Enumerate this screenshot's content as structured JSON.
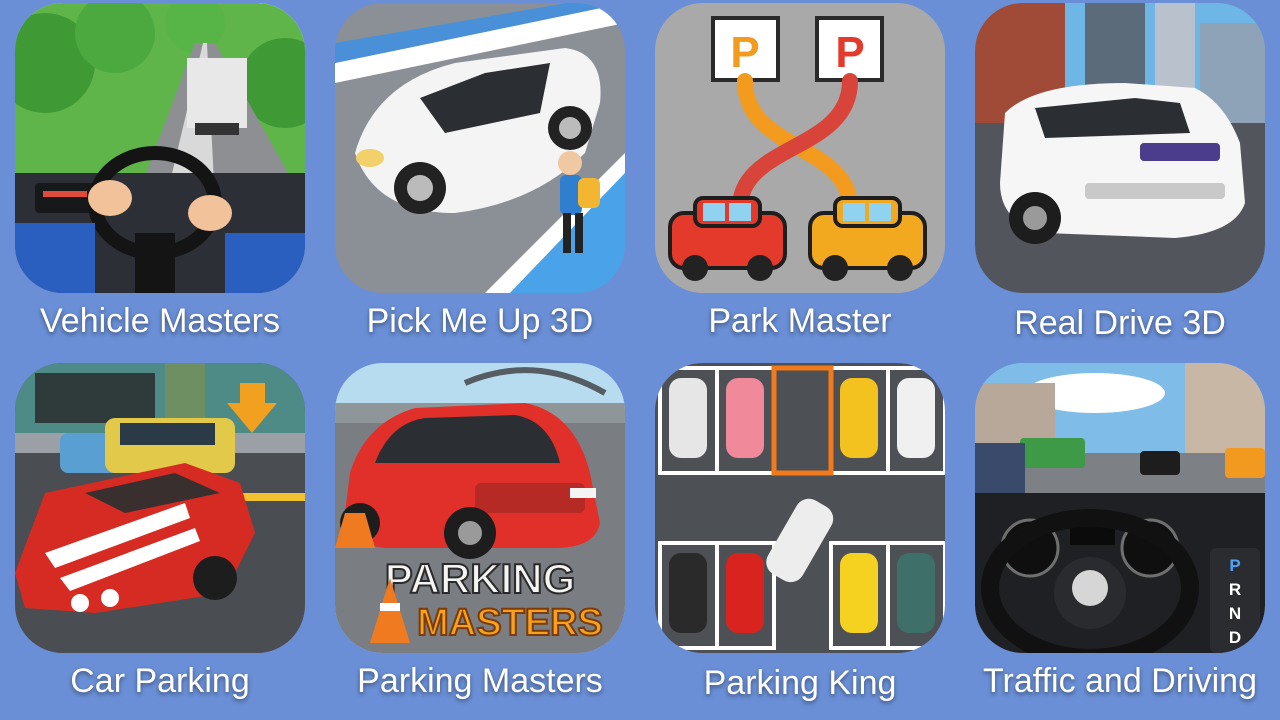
{
  "background_color": "#6a8fd6",
  "games": [
    {
      "title": "Vehicle Masters",
      "icon": "car-interior-steering-icon"
    },
    {
      "title": "Pick Me Up 3D",
      "icon": "white-car-passenger-icon"
    },
    {
      "title": "Park Master",
      "icon": "parking-path-cars-icon"
    },
    {
      "title": "Real Drive 3D",
      "icon": "white-suv-city-icon"
    },
    {
      "title": "Car Parking",
      "icon": "red-muscle-car-parking-icon"
    },
    {
      "title": "Parking Masters",
      "icon": "red-hatchback-cone-icon"
    },
    {
      "title": "Parking King",
      "icon": "parking-lot-topdown-icon"
    },
    {
      "title": "Traffic and Driving",
      "icon": "dashboard-steering-wheel-icon"
    }
  ],
  "park_master": {
    "sign_left": "P",
    "sign_right": "P"
  },
  "parking_masters": {
    "logo_line1": "PARKING",
    "logo_line2": "MASTERS"
  },
  "traffic_gears": [
    "P",
    "R",
    "N",
    "D"
  ]
}
